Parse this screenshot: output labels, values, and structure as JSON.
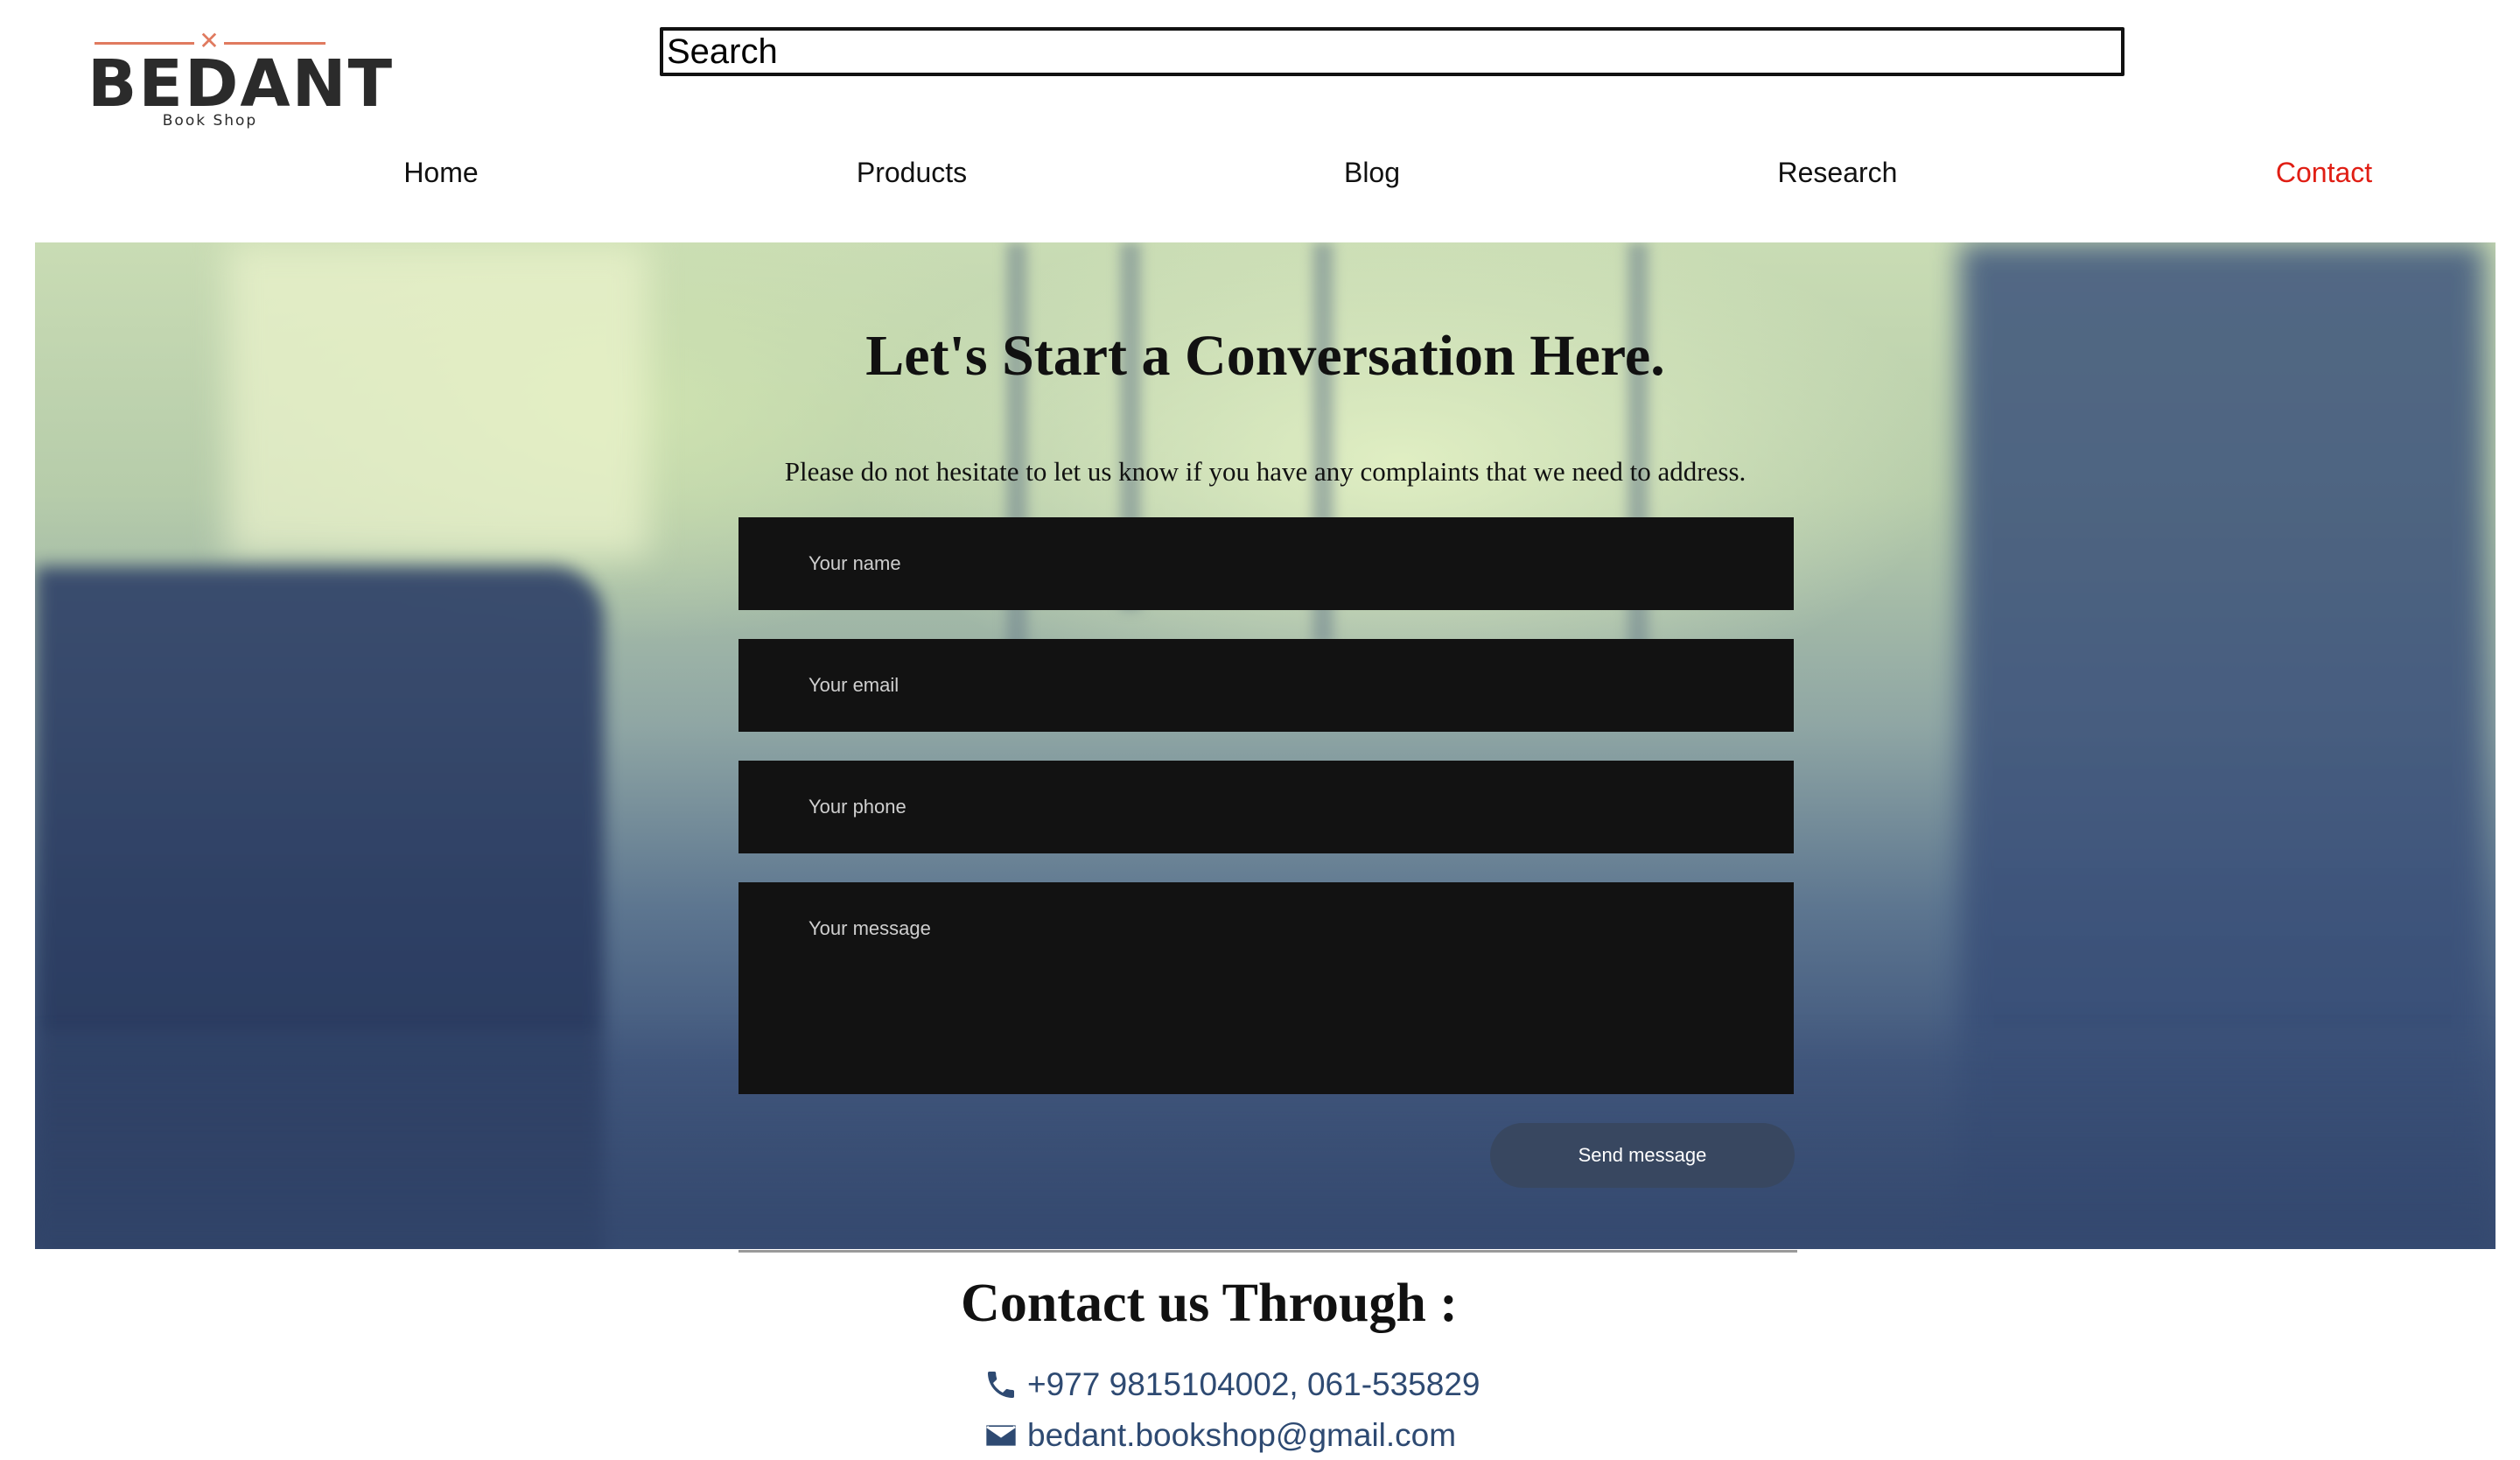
{
  "header": {
    "logo": {
      "name": "BEDANT",
      "tagline": "Book Shop"
    },
    "search": {
      "placeholder": "Search"
    }
  },
  "nav": {
    "items": [
      {
        "label": "Home",
        "active": false
      },
      {
        "label": "Products",
        "active": false
      },
      {
        "label": "Blog",
        "active": false
      },
      {
        "label": "Research",
        "active": false
      },
      {
        "label": "Contact",
        "active": true
      }
    ]
  },
  "hero": {
    "title": "Let's Start a Conversation Here.",
    "subtitle": "Please do not hesitate to let us know if you have any complaints that we need to address.",
    "form": {
      "name_placeholder": "Your name",
      "email_placeholder": "Your email",
      "phone_placeholder": "Your phone",
      "message_placeholder": "Your message",
      "submit_label": "Send message"
    }
  },
  "contact": {
    "title": "Contact us Through :",
    "phone": "+977 9815104002, 061-535829",
    "email": "bedant.bookshop@gmail.com"
  },
  "colors": {
    "nav_active": "#e01e14",
    "logo_accent": "#e07a5f",
    "field_background": "#121212",
    "button_background": "#384760",
    "contact_text": "#2e4a72"
  }
}
